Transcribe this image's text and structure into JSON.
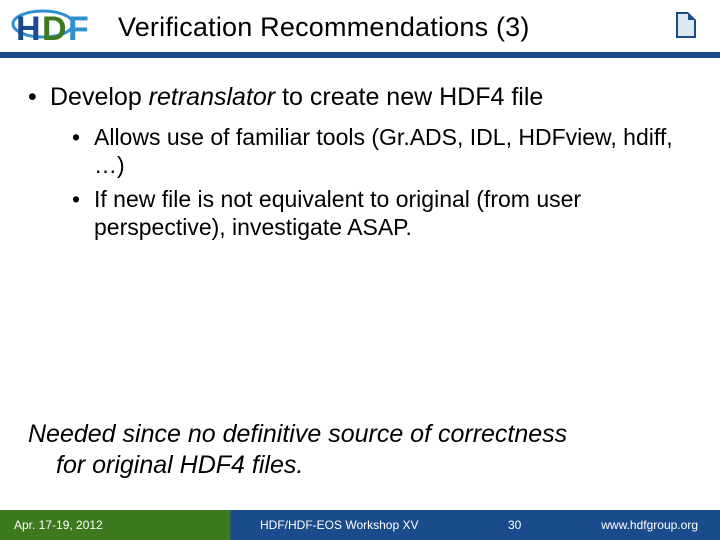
{
  "header": {
    "title": "Verification Recommendations (3)"
  },
  "content": {
    "main_pre": "Develop ",
    "main_em": "retranslator",
    "main_post": " to create new HDF4 file",
    "sub1": "Allows use of familiar tools (Gr.ADS, IDL, HDFview, hdiff, …)",
    "sub2": "If new file is not equivalent to original (from user perspective), investigate ASAP."
  },
  "note": {
    "line1": "Needed since no definitive source of correctness",
    "line2": "for original HDF4 files."
  },
  "footer": {
    "date": "Apr. 17-19, 2012",
    "venue": "HDF/HDF-EOS Workshop XV",
    "page": "30",
    "url": "www.hdfgroup.org"
  }
}
